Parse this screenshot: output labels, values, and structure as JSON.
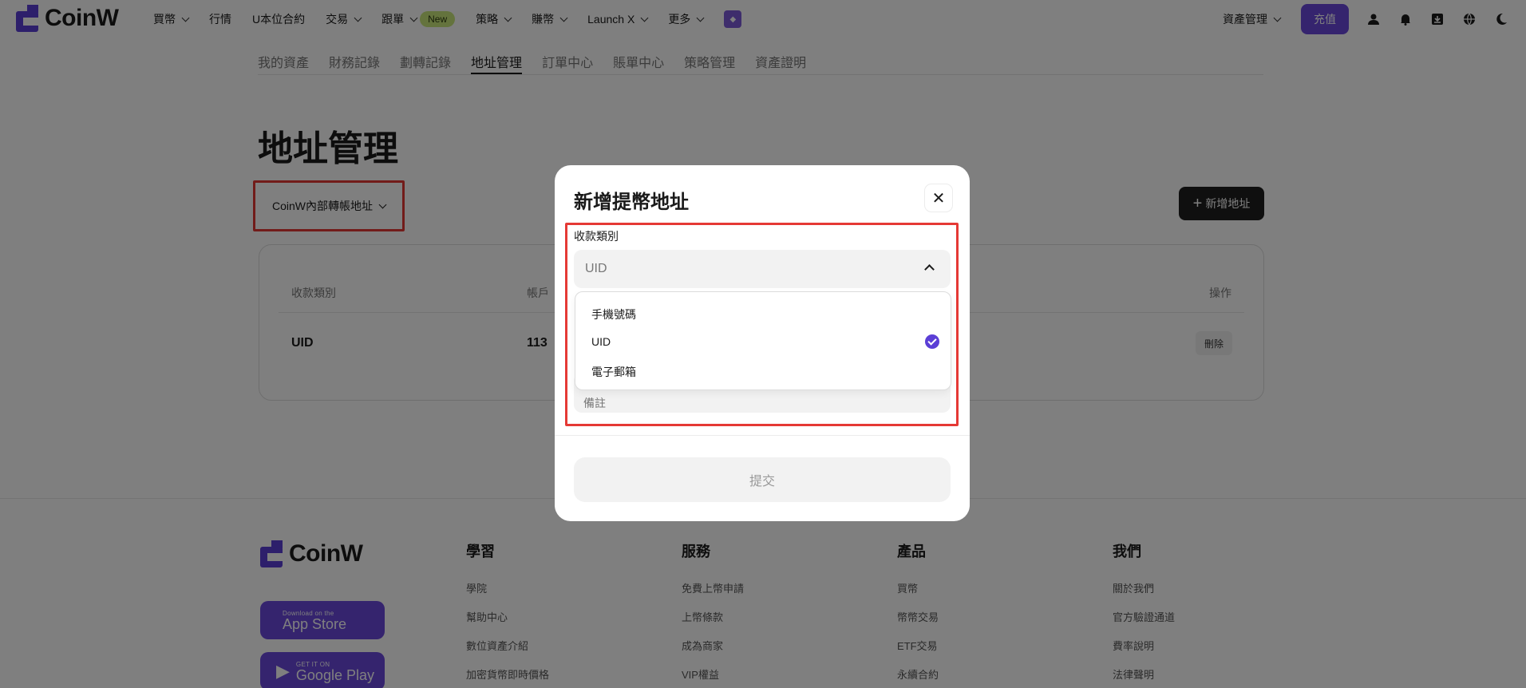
{
  "header": {
    "logo_text": "CoinW",
    "nav": [
      {
        "label": "買幣",
        "has_dropdown": true
      },
      {
        "label": "行情",
        "has_dropdown": false
      },
      {
        "label": "U本位合約",
        "has_dropdown": false
      },
      {
        "label": "交易",
        "has_dropdown": true
      },
      {
        "label": "跟單",
        "has_dropdown": true,
        "badge": "New"
      },
      {
        "label": "策略",
        "has_dropdown": true
      },
      {
        "label": "賺幣",
        "has_dropdown": true
      },
      {
        "label": "Launch X",
        "has_dropdown": true
      },
      {
        "label": "更多",
        "has_dropdown": true
      }
    ],
    "asset_mgmt": "資產管理",
    "deposit": "充值",
    "icons": [
      "user-icon",
      "bell-icon",
      "download-icon",
      "globe-icon",
      "moon-icon"
    ]
  },
  "subnav": {
    "items": [
      "我的資產",
      "財務記錄",
      "劃轉記錄",
      "地址管理",
      "訂單中心",
      "賬單中心",
      "策略管理",
      "資產證明"
    ],
    "active": "地址管理"
  },
  "page": {
    "title": "地址管理",
    "type_select": "CoinW內部轉帳地址",
    "add_button": "新增地址"
  },
  "table": {
    "headers": {
      "type": "收款類別",
      "account": "帳戶",
      "action": "操作"
    },
    "rows": [
      {
        "type": "UID",
        "account": "113",
        "action": "刪除"
      }
    ]
  },
  "footer": {
    "logo_text": "CoinW",
    "app_store": {
      "small": "Download on the",
      "big": "App Store"
    },
    "google_play": {
      "small": "GET IT ON",
      "big": "Google Play"
    },
    "columns": [
      {
        "title": "學習",
        "links": [
          "學院",
          "幫助中心",
          "數位資產介紹",
          "加密貨幣即時價格"
        ]
      },
      {
        "title": "服務",
        "links": [
          "免費上幣申請",
          "上幣條款",
          "成為商家",
          "VIP權益"
        ]
      },
      {
        "title": "產品",
        "links": [
          "買幣",
          "幣幣交易",
          "ETF交易",
          "永續合約"
        ]
      },
      {
        "title": "我們",
        "links": [
          "關於我們",
          "官方驗證通道",
          "費率說明",
          "法律聲明"
        ]
      }
    ]
  },
  "modal": {
    "title": "新增提幣地址",
    "field_label": "收款類別",
    "selected": "UID",
    "options": [
      "手機號碼",
      "UID",
      "電子郵箱"
    ],
    "remark_placeholder": "備註",
    "submit": "提交"
  },
  "colors": {
    "brand": "#6a48dc",
    "highlight": "#e53935"
  }
}
